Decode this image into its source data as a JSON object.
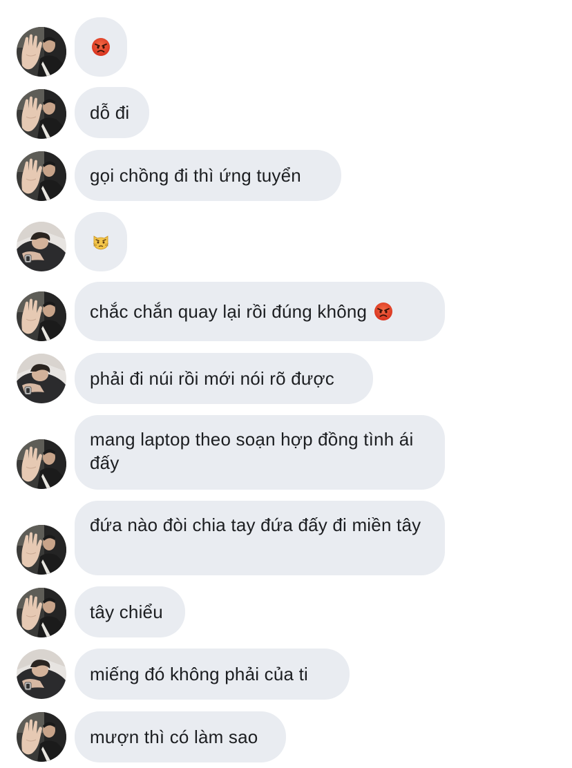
{
  "colors": {
    "bubble_bg": "#e9ecf1",
    "text": "#1c1e21",
    "angry_emoji": "#e8412c",
    "cat_emoji": "#f4c64a"
  },
  "messages": [
    {
      "sender": "a",
      "avatar_icon": "avatar-hand-raised-icon",
      "emoji": "angry-face-icon",
      "text": ""
    },
    {
      "sender": "a",
      "avatar_icon": "avatar-hand-raised-icon",
      "text": "dỗ đi"
    },
    {
      "sender": "a",
      "avatar_icon": "avatar-hand-raised-icon",
      "text": "gọi chồng đi thì ứng tuyển"
    },
    {
      "sender": "b",
      "avatar_icon": "avatar-leaning-man-icon",
      "emoji": "pouting-cat-icon",
      "text": ""
    },
    {
      "sender": "a",
      "avatar_icon": "avatar-hand-raised-icon",
      "text": "chắc chắn quay lại rồi đúng không",
      "trailing_emoji": "angry-face-icon"
    },
    {
      "sender": "b",
      "avatar_icon": "avatar-leaning-man-icon",
      "text": "phải đi núi rồi mới nói rõ được"
    },
    {
      "sender": "a",
      "avatar_icon": "avatar-hand-raised-icon",
      "text": "mang laptop theo soạn hợp đồng tình ái đấy"
    },
    {
      "sender": "a",
      "avatar_icon": "avatar-hand-raised-icon",
      "text": "đứa nào đòi chia tay đứa đấy đi miền tây"
    },
    {
      "sender": "a",
      "avatar_icon": "avatar-hand-raised-icon",
      "text": "tây chiểu"
    },
    {
      "sender": "b",
      "avatar_icon": "avatar-leaning-man-icon",
      "text": "miếng đó không phải của ti"
    },
    {
      "sender": "a",
      "avatar_icon": "avatar-hand-raised-icon",
      "text": "mượn thì có làm sao"
    }
  ]
}
